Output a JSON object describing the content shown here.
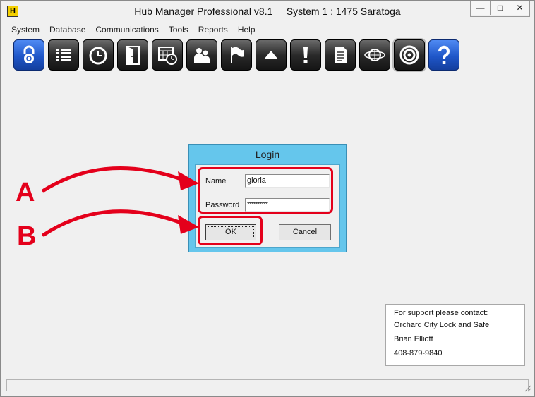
{
  "window": {
    "title": "Hub Manager Professional v8.1     System 1 : 1475 Saratoga",
    "app_icon_letter": "H",
    "controls": {
      "minimize": "—",
      "maximize": "□",
      "close": "✕"
    }
  },
  "menu": [
    "System",
    "Database",
    "Communications",
    "Tools",
    "Reports",
    "Help"
  ],
  "toolbar": [
    {
      "icon": "lock-icon"
    },
    {
      "icon": "list-icon"
    },
    {
      "icon": "clock-icon"
    },
    {
      "icon": "door-icon"
    },
    {
      "icon": "calendar-clock-icon"
    },
    {
      "icon": "people-icon"
    },
    {
      "icon": "flag-icon"
    },
    {
      "icon": "up-arrow-icon"
    },
    {
      "icon": "exclamation-icon"
    },
    {
      "icon": "document-icon"
    },
    {
      "icon": "globe-icon"
    },
    {
      "icon": "target-icon"
    },
    {
      "icon": "help-icon"
    }
  ],
  "login": {
    "title": "Login",
    "name_label": "Name",
    "name_value": "gloria",
    "password_label": "Password",
    "password_value": "**********",
    "ok_label": "OK",
    "cancel_label": "Cancel"
  },
  "annotations": {
    "a": "A",
    "b": "B",
    "color": "#e4001b"
  },
  "support": {
    "line1": "For support please contact:",
    "line2": "Orchard City Lock and Safe",
    "line3": "Brian Elliott",
    "line4": "408-879-9840"
  }
}
